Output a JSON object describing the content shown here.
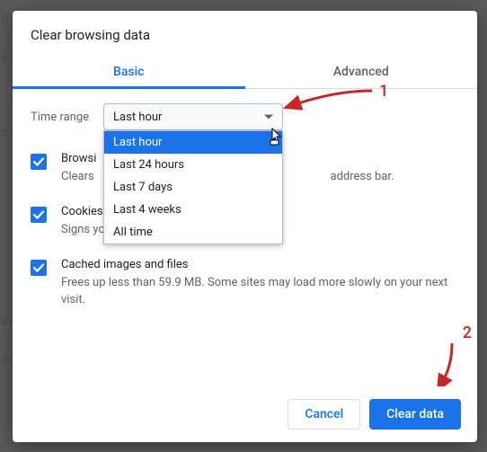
{
  "dialog": {
    "title": "Clear browsing data",
    "tabs": {
      "basic": "Basic",
      "advanced": "Advanced"
    },
    "timeRange": {
      "label": "Time range",
      "selected": "Last hour",
      "options": [
        "Last hour",
        "Last 24 hours",
        "Last 7 days",
        "Last 4 weeks",
        "All time"
      ]
    },
    "items": {
      "history": {
        "title_leading": "Browsi",
        "title_full": "Browsing history",
        "desc_leading": "Clears ",
        "desc_trailing": "address bar."
      },
      "cookies": {
        "title": "Cookies and other site data",
        "desc": "Signs you out of most sites."
      },
      "cache": {
        "title": "Cached images and files",
        "desc": "Frees up less than 59.9 MB. Some sites may load more slowly on your next visit."
      }
    },
    "buttons": {
      "cancel": "Cancel",
      "ok": "Clear data"
    }
  },
  "annotations": {
    "one": "1",
    "two": "2"
  }
}
